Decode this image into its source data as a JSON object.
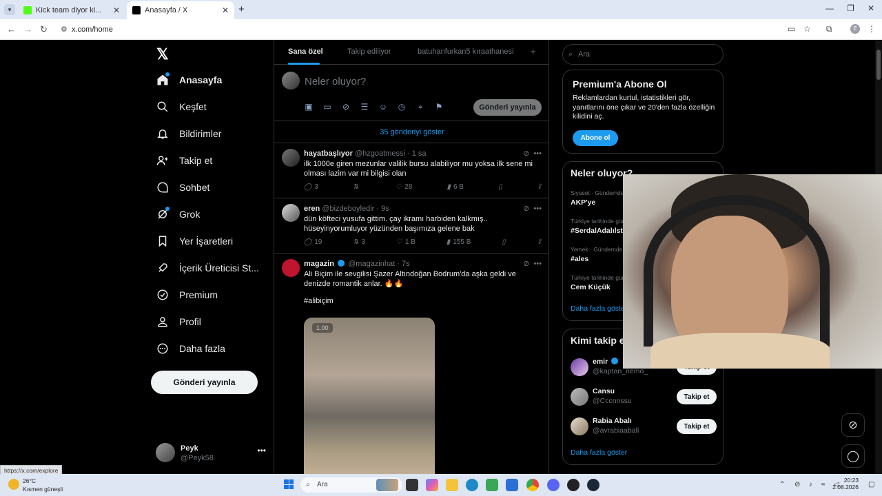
{
  "browser": {
    "tabs": [
      {
        "label": "Kick team diyor ki..."
      },
      {
        "label": "Anasayfa / X"
      }
    ],
    "url": "x.com/home",
    "profile_initial": "E",
    "status_url": "https://x.com/explore"
  },
  "nav": {
    "items": [
      {
        "label": "Anasayfa",
        "icon": "home-icon"
      },
      {
        "label": "Keşfet",
        "icon": "search-icon"
      },
      {
        "label": "Bildirimler",
        "icon": "bell-icon"
      },
      {
        "label": "Takip et",
        "icon": "add-user-icon"
      },
      {
        "label": "Sohbet",
        "icon": "chat-icon"
      },
      {
        "label": "Grok",
        "icon": "grok-icon"
      },
      {
        "label": "Yer İşaretleri",
        "icon": "bookmark-icon"
      },
      {
        "label": "İçerik Üreticisi St...",
        "icon": "rocket-icon"
      },
      {
        "label": "Premium",
        "icon": "verified-icon"
      },
      {
        "label": "Profil",
        "icon": "person-icon"
      },
      {
        "label": "Daha fazla",
        "icon": "more-circle-icon"
      }
    ],
    "post_button": "Gönderi yayınla",
    "me": {
      "name": "Peyk",
      "handle": "@Peyk58"
    }
  },
  "feed": {
    "tabs": [
      "Sana özel",
      "Takip ediliyor",
      "batuhanfurkan5 kıraathanesi"
    ],
    "compose_placeholder": "Neler oluyor?",
    "compose_button": "Gönderi yayınla",
    "show_more": "35 gönderiyi göster",
    "tweets": [
      {
        "name": "hayatbaşlıyor",
        "handle": "@hzgoatmessi",
        "time": "· 1 sa",
        "text": "ilk 1000e giren mezunlar valilik bursu alabiliyor mu yoksa ilk sene mi olması lazim var mi bilgisi olan",
        "replies": "3",
        "reposts": "",
        "likes": "28",
        "views": "6 B"
      },
      {
        "name": "eren",
        "handle": "@bizdeboyledir",
        "time": "· 9s",
        "text": "dün köfteci yusufa gittim. çay ikramı harbiden kalkmış.. hüseyinyorumluyor yüzünden başımıza gelene bak",
        "replies": "19",
        "reposts": "3",
        "likes": "1 B",
        "views": "155 B"
      },
      {
        "name": "magazin",
        "handle": "@magazinhat",
        "time": "· 7s",
        "text": "Ali Biçim ile sevgilisi Şazer Altındoğan Bodrum'da aşka geldi ve denizde romantik anlar. 🔥🔥",
        "hashtag": "#alibiçim",
        "media_label": "1.00"
      }
    ]
  },
  "right": {
    "search_placeholder": "Ara",
    "premium": {
      "title": "Premium'a Abone Ol",
      "desc": "Reklamlardan kurtul, istatistikleri gör, yanıtlarını öne çıkar ve 20'den fazla özelliğin kilidini aç.",
      "button": "Abone ol"
    },
    "trends": {
      "title": "Neler oluyor?",
      "items": [
        {
          "context": "Siyaset · Gündemde",
          "name": "AKP'ye"
        },
        {
          "context": "Türkiye tarihinde gündemde",
          "name": "#SerdalAdalıİst"
        },
        {
          "context": "Yemek · Gündemde",
          "name": "#ales"
        },
        {
          "context": "Türkiye tarihinde gündemde",
          "name": "Cem Küçük"
        }
      ],
      "more": "Daha fazla göster"
    },
    "follow": {
      "title": "Kimi takip et",
      "users": [
        {
          "name": "emir",
          "handle": "@kaptan_nemo_",
          "button": "Takip et"
        },
        {
          "name": "Cansu",
          "handle": "@Cccnnssu",
          "button": "Takip et"
        },
        {
          "name": "Rabia Abalı",
          "handle": "@avrabiaabali",
          "button": "Takip et"
        }
      ],
      "more": "Daha fazla göster"
    }
  },
  "taskbar": {
    "temp": "26°C",
    "weather": "Kısmen güneşli",
    "search": "Ara",
    "time": "20:23",
    "date": "2.08.2026"
  }
}
